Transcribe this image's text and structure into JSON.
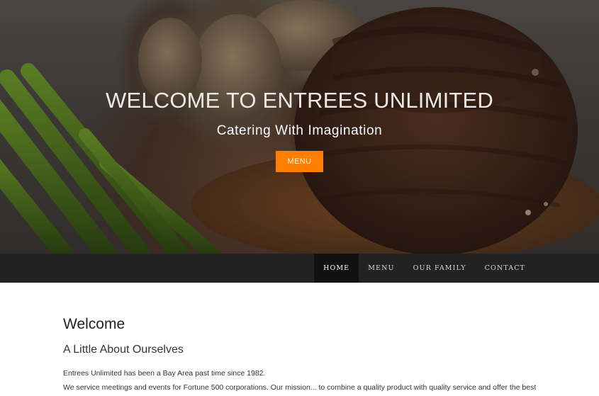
{
  "hero": {
    "title": "WELCOME TO ENTREES UNLIMITED",
    "subtitle": "Catering With Imagination",
    "button_label": "MENU",
    "button_color": "#ff7f00"
  },
  "nav": {
    "items": [
      {
        "label": "HOME",
        "active": true
      },
      {
        "label": "MENU",
        "active": false
      },
      {
        "label": "OUR FAMILY",
        "active": false
      },
      {
        "label": "CONTACT",
        "active": false
      }
    ]
  },
  "main": {
    "heading": "Welcome",
    "subheading": "A Little About Ourselves",
    "paragraphs": [
      "Entrees Unlimited has been a Bay Area past time since 1982.",
      "We service meetings and events for Fortune 500 corporations. Our mission... to combine a quality product with quality service and offer the best"
    ]
  }
}
